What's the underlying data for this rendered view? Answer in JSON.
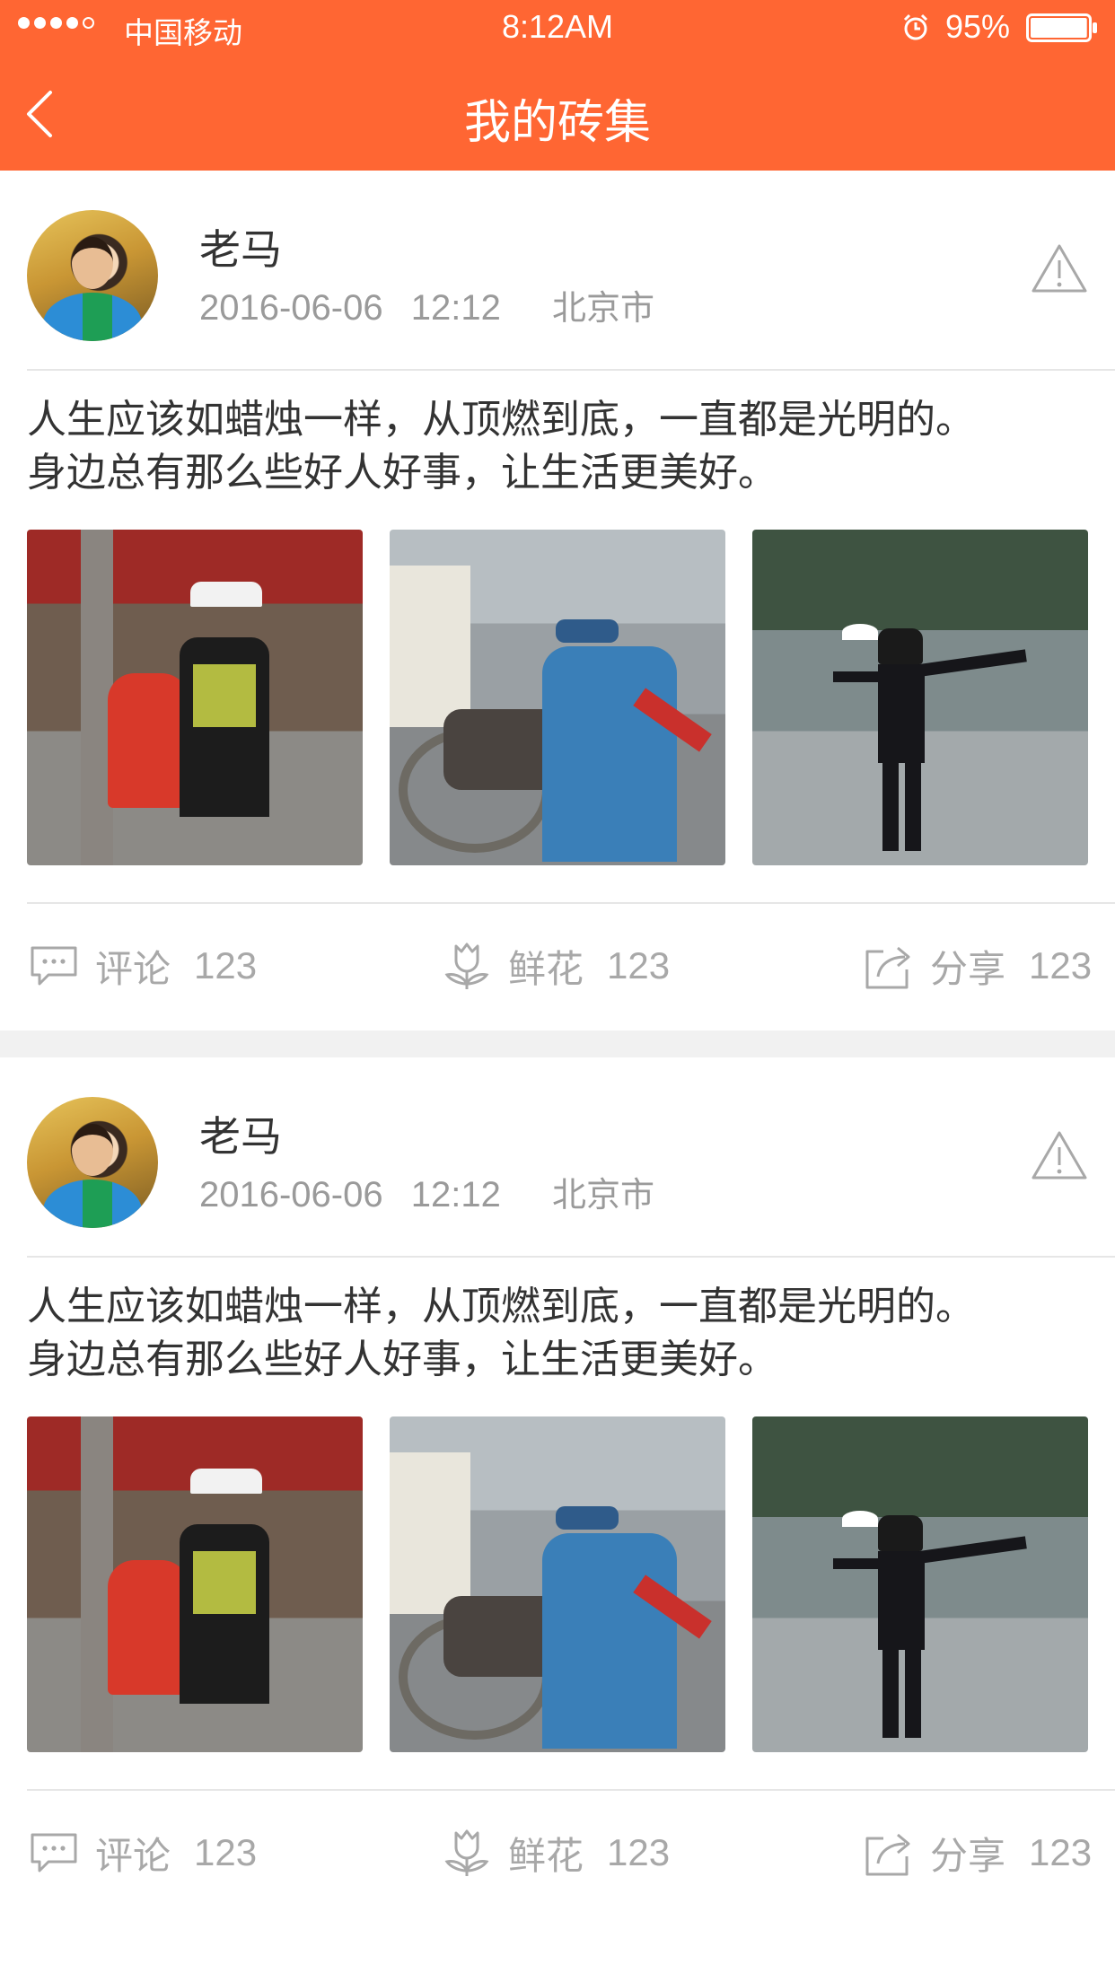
{
  "status_bar": {
    "carrier": "中国移动",
    "time": "8:12AM",
    "battery_percent": "95%",
    "battery_level": 0.95,
    "signal_bars": 4,
    "signal_max": 5
  },
  "nav": {
    "title": "我的砖集",
    "back_icon": "chevron-left-icon"
  },
  "colors": {
    "brand": "#FF6633",
    "text_primary": "#333333",
    "text_secondary": "#9a9a9a",
    "divider": "#e6e6e6"
  },
  "posts": [
    {
      "author": "老马",
      "date": "2016-06-06",
      "time": "12:12",
      "location": "北京市",
      "content_line1": "人生应该如蜡烛一样，从顶燃到底，一直都是光明的。",
      "content_line2": "身边总有那么些好人好事，让生活更美好。",
      "images": [
        "traffic-police-helping-child-photo",
        "helping-elderly-wheelchair-photo",
        "police-directing-traffic-in-rain-photo"
      ],
      "actions": {
        "comment_label": "评论",
        "comment_count": "123",
        "flower_label": "鲜花",
        "flower_count": "123",
        "share_label": "分享",
        "share_count": "123"
      }
    },
    {
      "author": "老马",
      "date": "2016-06-06",
      "time": "12:12",
      "location": "北京市",
      "content_line1": "人生应该如蜡烛一样，从顶燃到底，一直都是光明的。",
      "content_line2": "身边总有那么些好人好事，让生活更美好。",
      "images": [
        "traffic-police-helping-child-photo",
        "helping-elderly-wheelchair-photo",
        "police-directing-traffic-in-rain-photo"
      ],
      "actions": {
        "comment_label": "评论",
        "comment_count": "123",
        "flower_label": "鲜花",
        "flower_count": "123",
        "share_label": "分享",
        "share_count": "123"
      }
    }
  ]
}
